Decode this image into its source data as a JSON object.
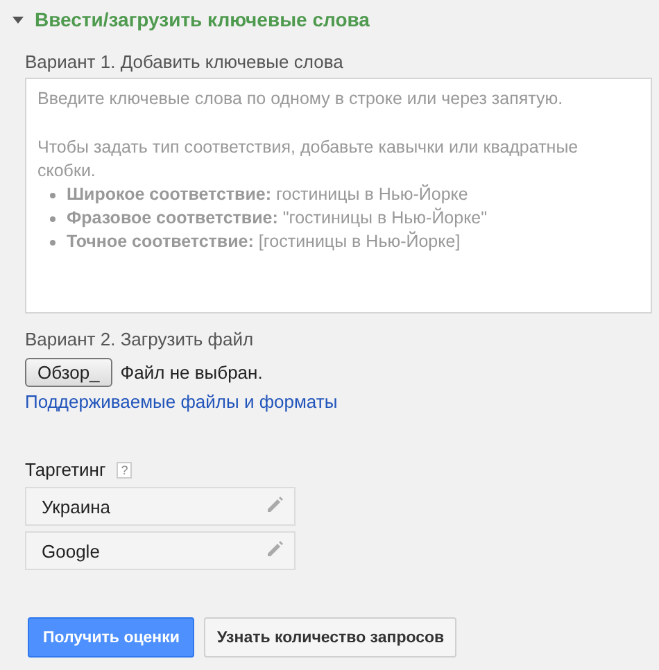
{
  "section": {
    "title": "Ввести/загрузить ключевые слова",
    "expanded": true
  },
  "option1": {
    "label": "Вариант 1. Добавить ключевые слова",
    "placeholder": {
      "intro": "Введите ключевые слова по одному в строке или через запятую.",
      "hint": "Чтобы задать тип соответствия, добавьте кавычки или квадратные скобки.",
      "examples": [
        "**Широкое соответствие:** гостиницы в Нью-Йорке",
        "**Фразовое соответствие:** \"гостиницы в Нью-Йорке\"",
        "**Точное соответствие:** [гостиницы в Нью-Йорке]"
      ]
    }
  },
  "option2": {
    "label": "Вариант 2. Загрузить файл",
    "browse_button": "Обзор_",
    "file_status": "Файл не выбран.",
    "link": "Поддерживаемые файлы и форматы"
  },
  "targeting": {
    "label": "Таргетинг",
    "help": "?",
    "items": [
      "Украина",
      "Google"
    ]
  },
  "buttons": [
    {
      "label": "Получить оценки",
      "kind": "primary"
    },
    {
      "label": "Узнать количество запросов",
      "kind": "secondary"
    }
  ]
}
